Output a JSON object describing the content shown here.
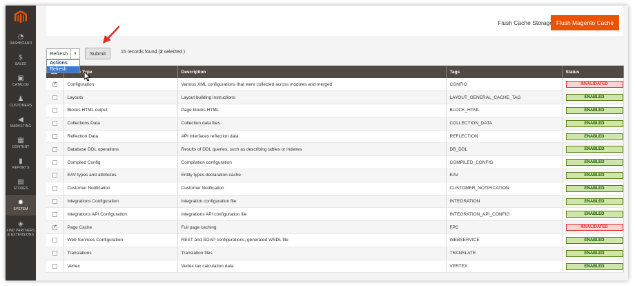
{
  "sidebar": {
    "items": [
      {
        "label": "DASHBOARD",
        "icon": "dashboard-icon",
        "glyph": "◔"
      },
      {
        "label": "SALES",
        "icon": "dollar-icon",
        "glyph": "$"
      },
      {
        "label": "CATALOG",
        "icon": "catalog-box-icon",
        "glyph": "▣"
      },
      {
        "label": "CUSTOMERS",
        "icon": "customer-person-icon",
        "glyph": "♟"
      },
      {
        "label": "MARKETING",
        "icon": "megaphone-icon",
        "glyph": "◀"
      },
      {
        "label": "CONTENT",
        "icon": "content-grid-icon",
        "glyph": "▦"
      },
      {
        "label": "REPORTS",
        "icon": "bar-chart-icon",
        "glyph": "▮"
      },
      {
        "label": "STORES",
        "icon": "store-icon",
        "glyph": "▤"
      },
      {
        "label": "SYSTEM",
        "icon": "gear-icon",
        "glyph": "✸"
      },
      {
        "label": "FIND PARTNERS & EXTENSIONS",
        "icon": "extensions-cube-icon",
        "glyph": "◈"
      }
    ]
  },
  "header": {
    "flush_storage_label": "Flush Cache Storage",
    "flush_magento_label": "Flush Magento Cache"
  },
  "actions": {
    "selected": "Refresh",
    "dropdown_header": "Actions",
    "dropdown_option": "Refresh",
    "submit_label": "Submit",
    "records_prefix": "15 records found (",
    "records_selected": "2",
    "records_suffix": " selected )"
  },
  "grid": {
    "columns": [
      "Cache Type",
      "Description",
      "Tags",
      "Status"
    ],
    "rows": [
      {
        "checked": true,
        "type": "Configuration",
        "description": "Various XML configurations that were collected across modules and merged",
        "tags": "CONFIG",
        "status": "INVALIDATED"
      },
      {
        "checked": false,
        "type": "Layouts",
        "description": "Layout building instructions",
        "tags": "LAYOUT_GENERAL_CACHE_TAG",
        "status": "ENABLED"
      },
      {
        "checked": false,
        "type": "Blocks HTML output",
        "description": "Page blocks HTML",
        "tags": "BLOCK_HTML",
        "status": "ENABLED"
      },
      {
        "checked": false,
        "type": "Collections Data",
        "description": "Collection data files",
        "tags": "COLLECTION_DATA",
        "status": "ENABLED"
      },
      {
        "checked": false,
        "type": "Reflection Data",
        "description": "API interfaces reflection data",
        "tags": "REFLECTION",
        "status": "ENABLED"
      },
      {
        "checked": false,
        "type": "Database DDL operations",
        "description": "Results of DDL queries, such as describing tables or indexes",
        "tags": "DB_DDL",
        "status": "ENABLED"
      },
      {
        "checked": false,
        "type": "Compiled Config",
        "description": "Compilation configuration",
        "tags": "COMPILED_CONFIG",
        "status": "ENABLED"
      },
      {
        "checked": false,
        "type": "EAV types and attributes",
        "description": "Entity types declaration cache",
        "tags": "EAV",
        "status": "ENABLED"
      },
      {
        "checked": false,
        "type": "Customer Notification",
        "description": "Customer Notification",
        "tags": "CUSTOMER_NOTIFICATION",
        "status": "ENABLED"
      },
      {
        "checked": false,
        "type": "Integrations Configuration",
        "description": "Integration configuration file",
        "tags": "INTEGRATION",
        "status": "ENABLED"
      },
      {
        "checked": false,
        "type": "Integrations API Configuration",
        "description": "Integrations API configuration file",
        "tags": "INTEGRATION_API_CONFIG",
        "status": "ENABLED"
      },
      {
        "checked": true,
        "type": "Page Cache",
        "description": "Full page caching",
        "tags": "FPC",
        "status": "INVALIDATED"
      },
      {
        "checked": false,
        "type": "Web Services Configuration",
        "description": "REST and SOAP configurations, generated WSDL file",
        "tags": "WEBSERVICE",
        "status": "ENABLED"
      },
      {
        "checked": false,
        "type": "Translations",
        "description": "Translation files",
        "tags": "TRANSLATE",
        "status": "ENABLED"
      },
      {
        "checked": false,
        "type": "Vertex",
        "description": "Vertex tax calculation data",
        "tags": "VERTEX",
        "status": "ENABLED"
      }
    ]
  },
  "colors": {
    "accent": "#eb5202",
    "sidebar_bg": "#373330",
    "header_bg": "#514943",
    "enabled_green": "#d0e5a9",
    "invalid_red": "#e22626",
    "annotation_arrow": "#e02b27"
  }
}
